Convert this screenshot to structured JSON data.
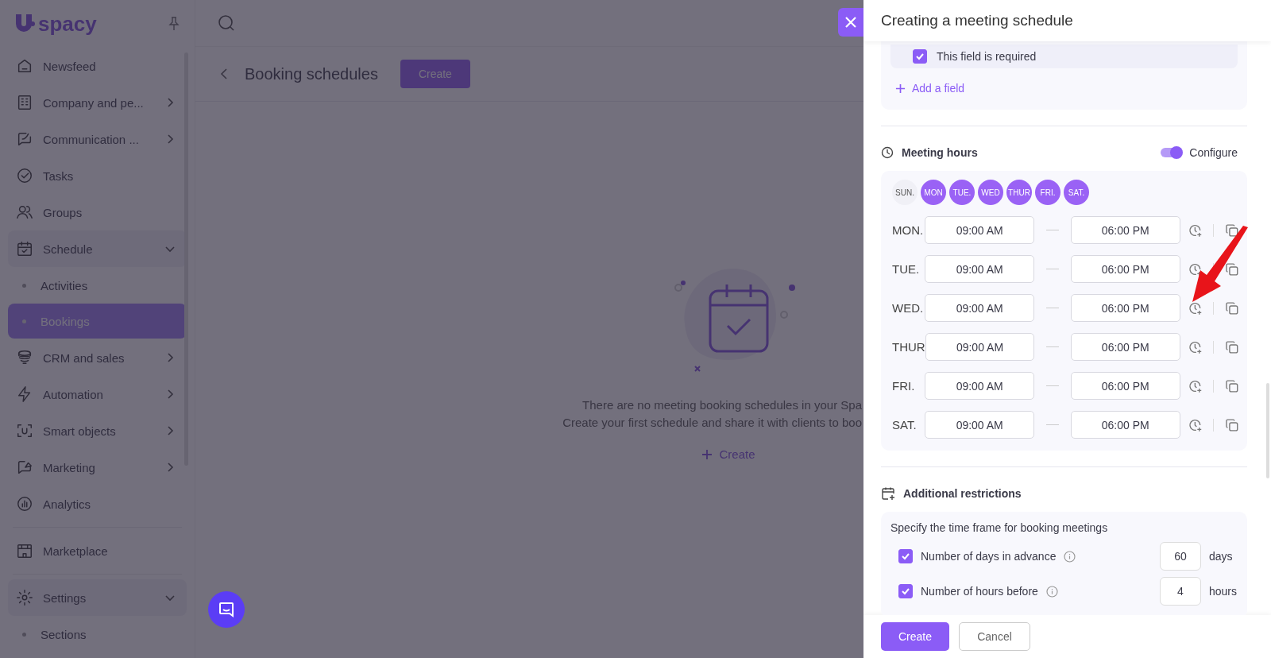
{
  "sidebar": {
    "logo": "spacy",
    "sections": [
      [
        {
          "label": "Newsfeed",
          "selected": false
        },
        {
          "label": "Company and pe...",
          "selected": false,
          "expanded": false
        },
        {
          "label": "Communication ...",
          "selected": false,
          "expanded": false
        },
        {
          "label": "Tasks",
          "selected": false
        },
        {
          "label": "Groups",
          "selected": false
        },
        {
          "label": "Schedule",
          "selected": false,
          "expanded": true,
          "children": [
            {
              "label": "Activities",
              "selected": false
            },
            {
              "label": "Bookings",
              "selected": true
            }
          ]
        },
        {
          "label": "CRM and sales",
          "selected": false,
          "expanded": false
        },
        {
          "label": "Automation",
          "selected": false,
          "expanded": false
        },
        {
          "label": "Smart objects",
          "selected": false,
          "expanded": false
        },
        {
          "label": "Marketing",
          "selected": false,
          "expanded": false
        },
        {
          "label": "Analytics",
          "selected": false
        }
      ],
      [
        {
          "label": "Marketplace",
          "selected": false
        }
      ],
      [
        {
          "label": "Settings",
          "selected": false,
          "expanded": true,
          "children": [
            {
              "label": "Sections",
              "selected": false
            }
          ]
        }
      ]
    ]
  },
  "main": {
    "page_title": "Booking schedules",
    "create_button": "Create",
    "empty_state": {
      "lines": [
        "There are no meeting booking schedules in your Spa",
        "Create your first schedule and share it with clients to boo"
      ],
      "create_link": "Create"
    }
  },
  "drawer": {
    "title": "Creating a meeting schedule",
    "required_checkbox": {
      "label": "This field is required",
      "checked": true
    },
    "add_field_link": "Add a field",
    "meeting_hours": {
      "title": "Meeting hours",
      "configure": {
        "label": "Configure",
        "on": true
      },
      "days": [
        {
          "label": "SUN.",
          "selected": false
        },
        {
          "label": "MON",
          "selected": true
        },
        {
          "label": "TUE.",
          "selected": true
        },
        {
          "label": "WED",
          "selected": true
        },
        {
          "label": "THUR",
          "selected": true
        },
        {
          "label": "FRI.",
          "selected": true
        },
        {
          "label": "SAT.",
          "selected": true
        }
      ],
      "rows": [
        {
          "day": "MON.",
          "start": "09:00 AM",
          "end": "06:00 PM"
        },
        {
          "day": "TUE.",
          "start": "09:00 AM",
          "end": "06:00 PM"
        },
        {
          "day": "WED.",
          "start": "09:00 AM",
          "end": "06:00 PM"
        },
        {
          "day": "THUR",
          "start": "09:00 AM",
          "end": "06:00 PM"
        },
        {
          "day": "FRI.",
          "start": "09:00 AM",
          "end": "06:00 PM"
        },
        {
          "day": "SAT.",
          "start": "09:00 AM",
          "end": "06:00 PM"
        }
      ]
    },
    "restrictions": {
      "title": "Additional restrictions",
      "hint": "Specify the time frame for booking meetings",
      "rules": [
        {
          "label": "Number of days in advance",
          "checked": true,
          "value": "60",
          "unit": "days"
        },
        {
          "label": "Number of hours before",
          "checked": true,
          "value": "4",
          "unit": "hours"
        }
      ]
    },
    "buttons": {
      "create": "Create",
      "cancel": "Cancel"
    }
  }
}
